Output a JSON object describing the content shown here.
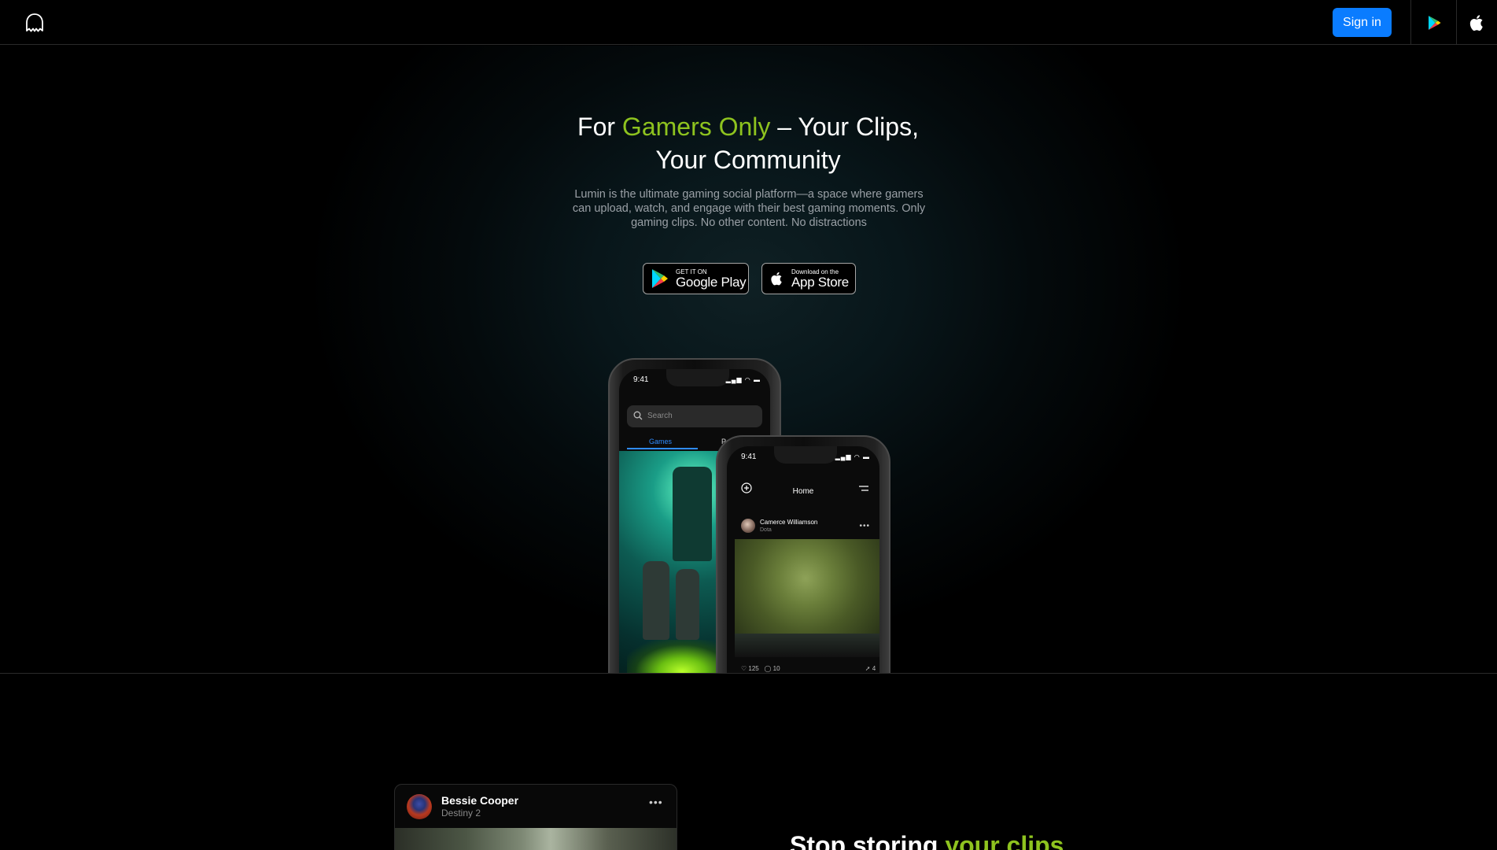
{
  "header": {
    "logo_icon": "ghost-icon",
    "signin_label": "Sign in",
    "play_icon": "google-play-icon",
    "apple_icon": "apple-icon",
    "accent_color": "#0a7cff"
  },
  "hero": {
    "title_pre": "For ",
    "title_accent": "Gamers Only",
    "title_line1_post": " – Your Clips,",
    "title_line2": "Your Community",
    "accent_color": "#8ec31f",
    "description": "Lumin is the ultimate gaming social platform—a space where gamers can upload, watch, and engage with their best gaming moments. Only gaming clips. No other content. No distractions",
    "google_play": {
      "small": "GET IT ON",
      "big": "Google Play"
    },
    "app_store": {
      "small": "Download on the",
      "big": "App Store"
    }
  },
  "phone_back": {
    "time": "9:41",
    "search_placeholder": "Search",
    "tab_games": "Games",
    "tab_people": "Peopl"
  },
  "phone_front": {
    "time": "9:41",
    "title": "Home",
    "post_user": "Camerce Williamson",
    "post_game": "Dota",
    "likes": "125",
    "comments": "10",
    "shares": "4"
  },
  "feed_card": {
    "name": "Bessie Cooper",
    "game": "Destiny 2"
  },
  "section2": {
    "heading_pre": "Stop storing ",
    "heading_accent": "your clips"
  }
}
